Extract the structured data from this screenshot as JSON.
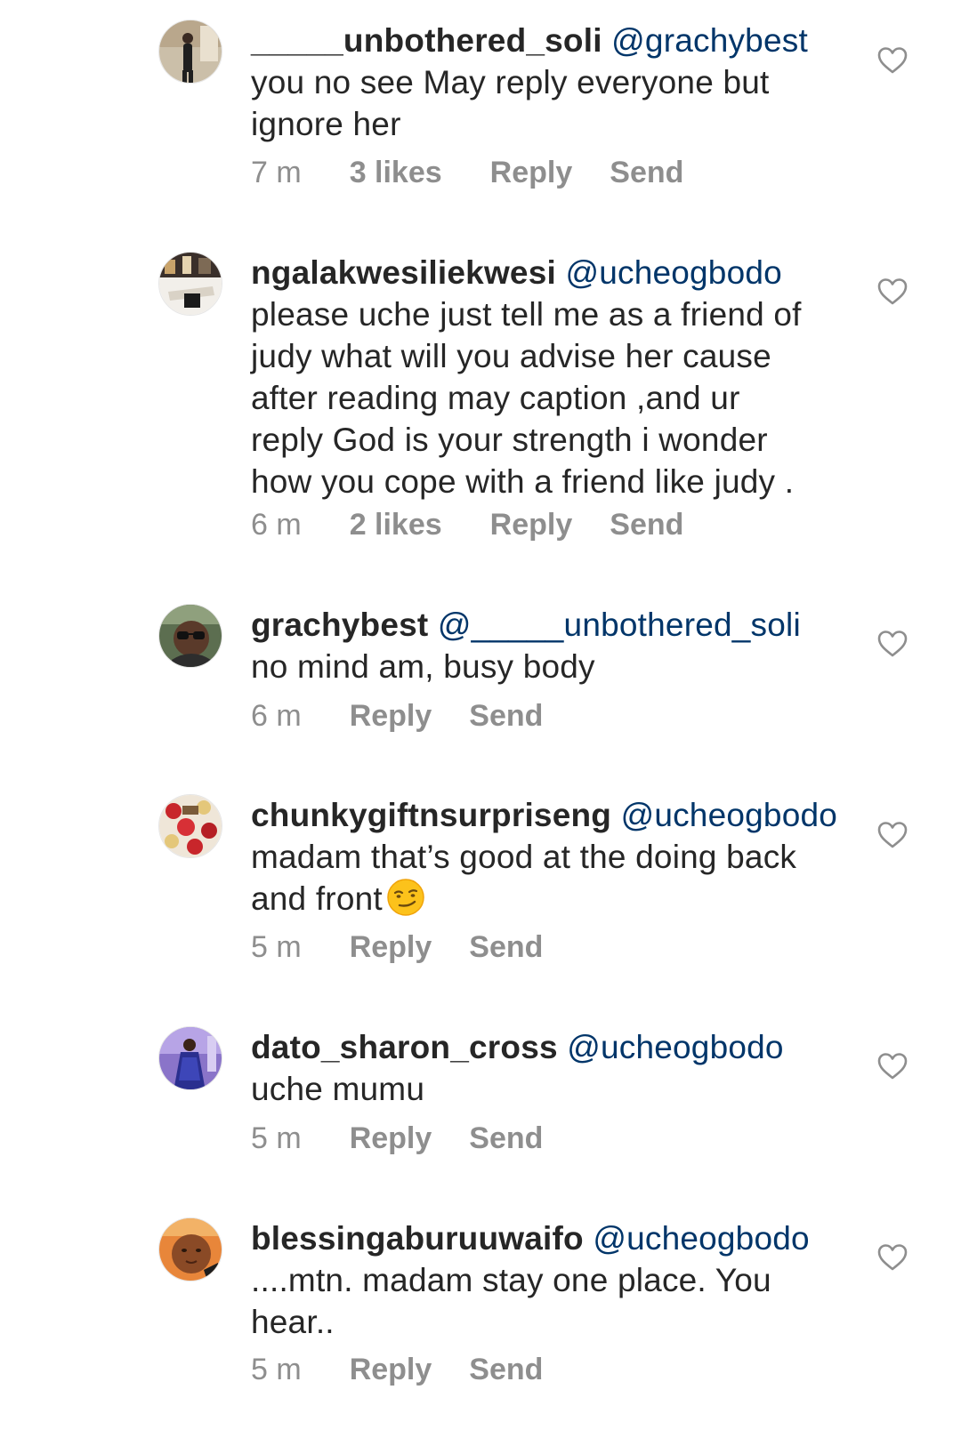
{
  "comments": [
    {
      "username": "_____unbothered_soli",
      "mention": "@grachybest",
      "lines": [
        "you no see May reply everyone but",
        "ignore her"
      ],
      "time": "7 m",
      "likes": "3 likes",
      "reply_label": "Reply",
      "send_label": "Send"
    },
    {
      "username": "ngalakwesiliekwesi",
      "mention": "@ucheogbodo",
      "lines": [
        "please uche just tell me as a friend of",
        "judy what will you advise her cause",
        "after reading may caption ,and ur",
        "reply God is your strength i wonder",
        "how you cope with a friend like judy ."
      ],
      "time": "6 m",
      "likes": "2 likes",
      "reply_label": "Reply",
      "send_label": "Send"
    },
    {
      "username": "grachybest",
      "mention": "@_____unbothered_soli",
      "lines": [
        "no mind am, busy body"
      ],
      "time": "6 m",
      "reply_label": "Reply",
      "send_label": "Send"
    },
    {
      "username": "chunkygiftnsurpriseng",
      "mention": "@ucheogbodo",
      "lines": [
        "madam that’s good at the doing back",
        "and front"
      ],
      "time": "5 m",
      "reply_label": "Reply",
      "send_label": "Send"
    },
    {
      "username": "dato_sharon_cross",
      "mention": "@ucheogbodo",
      "lines": [
        "uche mumu"
      ],
      "time": "5 m",
      "reply_label": "Reply",
      "send_label": "Send"
    },
    {
      "username": "blessingaburuuwaifo",
      "mention": "@ucheogbodo",
      "lines": [
        "....mtn. madam stay one place. You",
        "hear.."
      ],
      "time": "5 m",
      "reply_label": "Reply",
      "send_label": "Send"
    }
  ],
  "colors": {
    "text": "#262626",
    "mention": "#003569",
    "meta": "#8e8e8e",
    "heart": "#8e8e8e"
  },
  "icons": {
    "like": "heart-outline-icon",
    "emoji": "smirking-face-emoji"
  }
}
